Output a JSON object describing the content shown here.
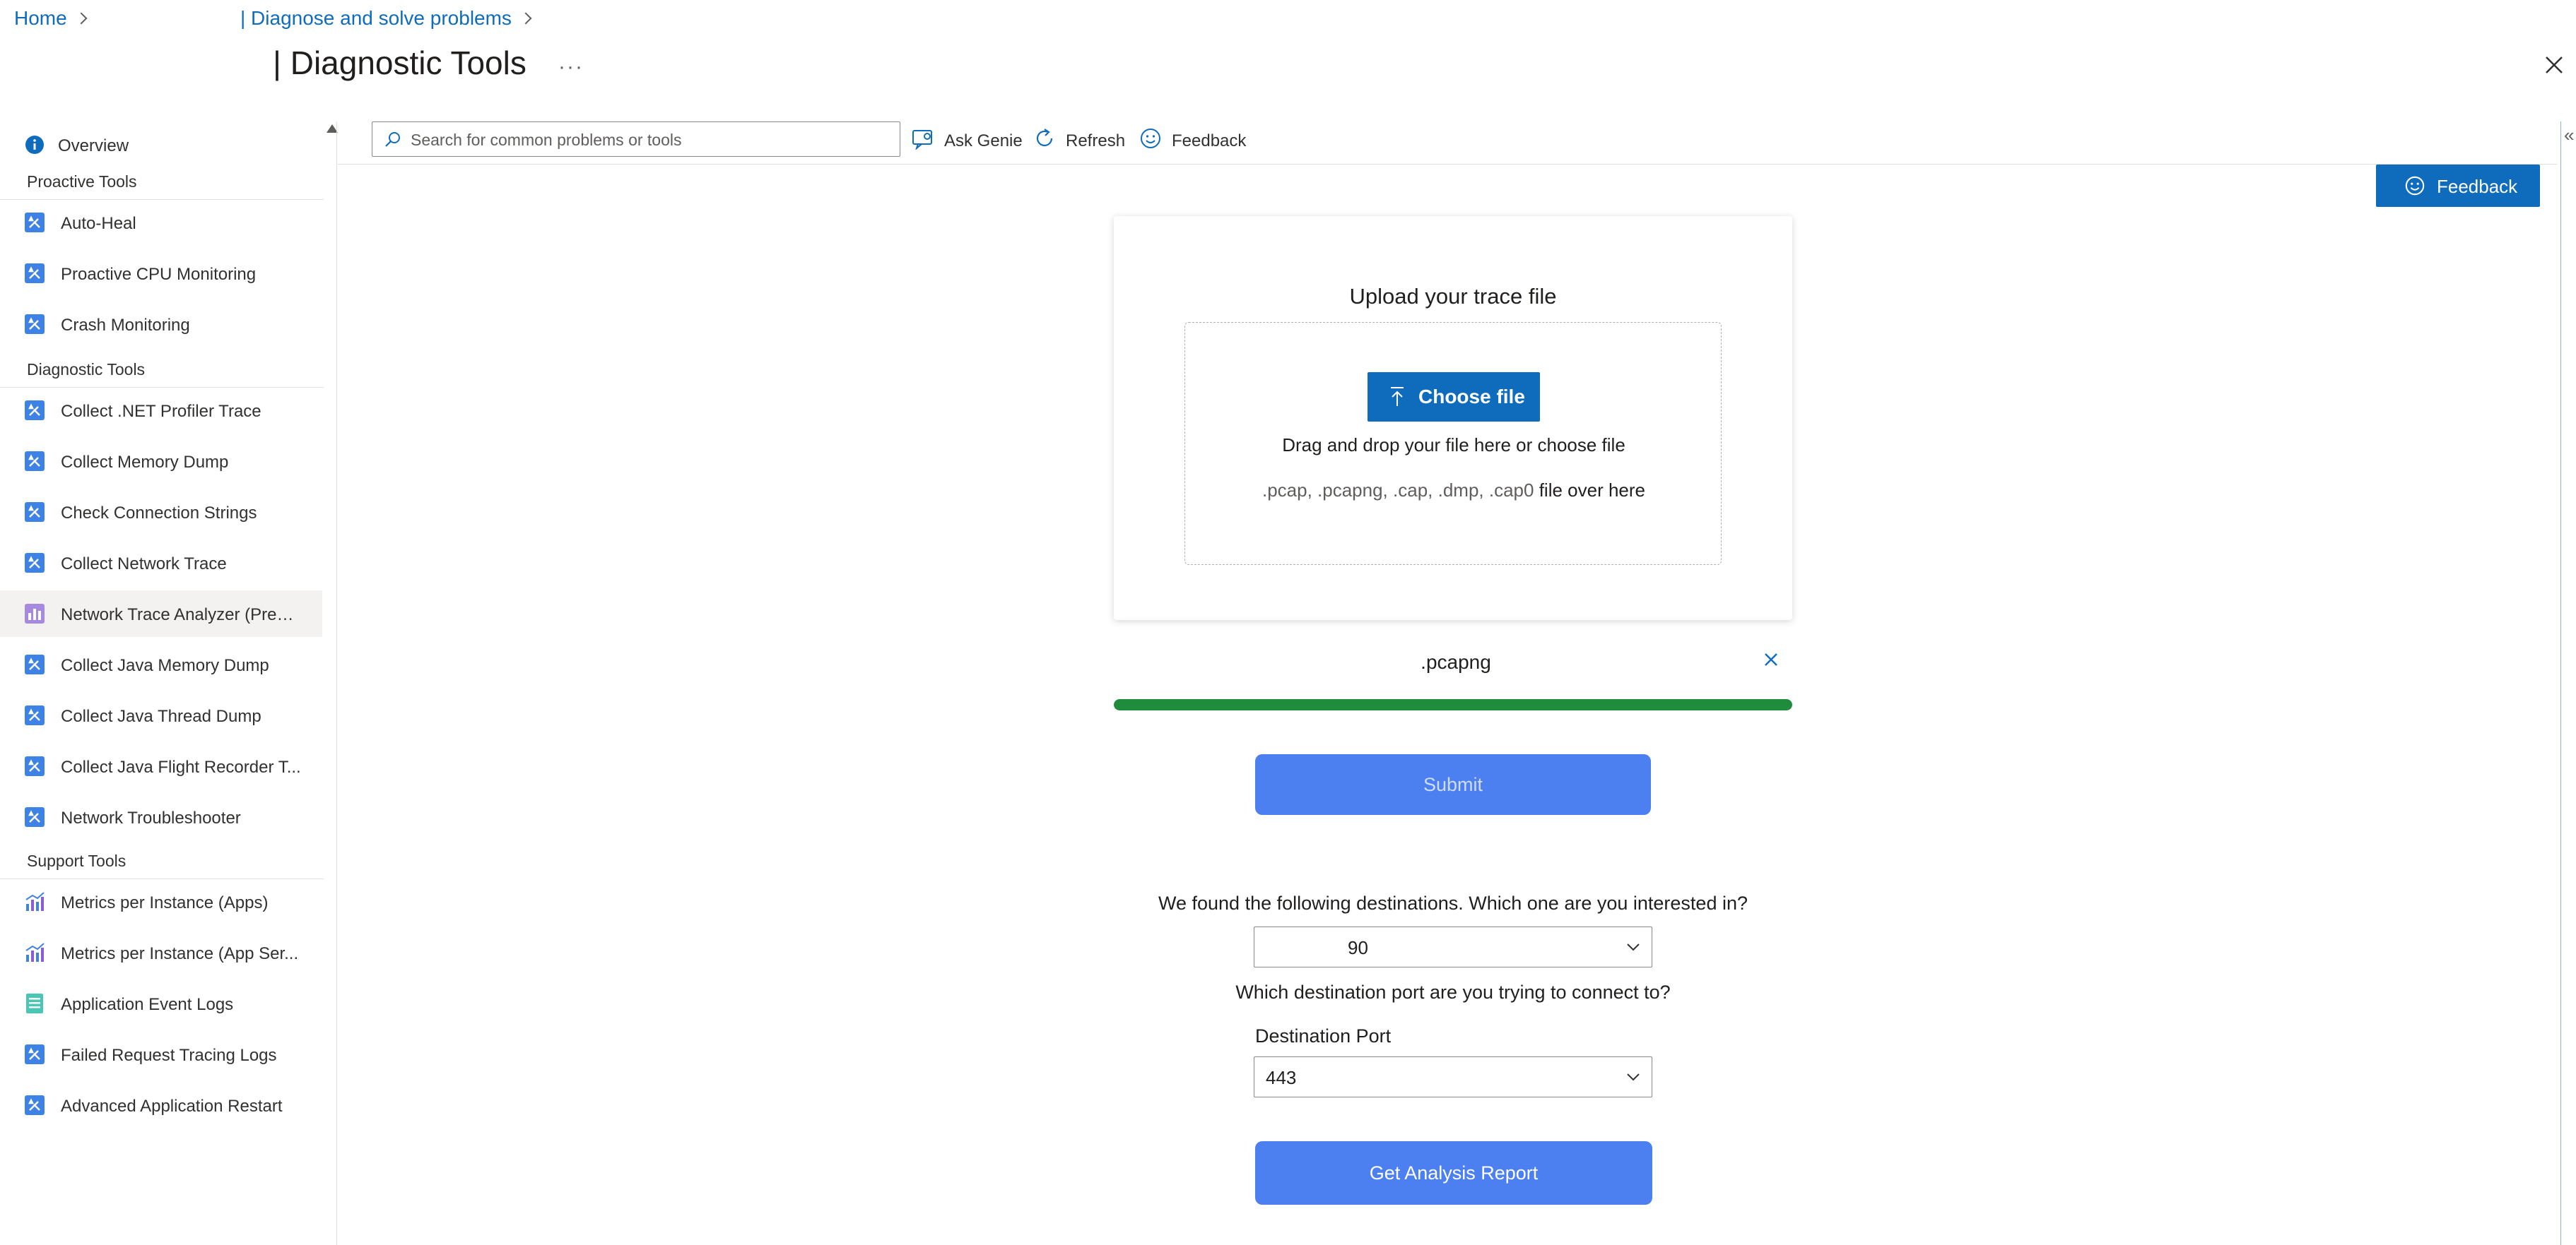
{
  "breadcrumb": {
    "home": "Home",
    "diagnose": "| Diagnose and solve problems"
  },
  "page": {
    "title": "| Diagnostic Tools",
    "more": "···"
  },
  "sidebar": {
    "overview": "Overview",
    "sections": [
      {
        "header": "Proactive Tools",
        "items": [
          "Auto-Heal",
          "Proactive CPU Monitoring",
          "Crash Monitoring"
        ]
      },
      {
        "header": "Diagnostic Tools",
        "items": [
          "Collect .NET Profiler Trace",
          "Collect Memory Dump",
          "Check Connection Strings",
          "Collect Network Trace",
          "Network Trace Analyzer (Previ...",
          "Collect Java Memory Dump",
          "Collect Java Thread Dump",
          "Collect Java Flight Recorder T...",
          "Network Troubleshooter"
        ]
      },
      {
        "header": "Support Tools",
        "items": [
          "Metrics per Instance (Apps)",
          "Metrics per Instance (App Ser...",
          "Application Event Logs",
          "Failed Request Tracing Logs",
          "Advanced Application Restart"
        ]
      }
    ],
    "selected": "Network Trace Analyzer (Previ..."
  },
  "toolbar": {
    "search_placeholder": "Search for common problems or tools",
    "ask_genie": "Ask Genie",
    "refresh": "Refresh",
    "feedback": "Feedback"
  },
  "feedback_button": "Feedback",
  "upload": {
    "title": "Upload your trace file",
    "choose_file": "Choose file",
    "drag_text": "Drag and drop your file here or choose file",
    "extensions": ".pcap, .pcapng, .cap, .dmp, .cap0",
    "over_here": "file over here"
  },
  "file": {
    "name": ".pcapng",
    "progress": 1.0
  },
  "submit_label": "Submit",
  "destinations": {
    "question": "We found the following destinations. Which one are you interested in?",
    "selected": "90"
  },
  "port": {
    "question": "Which destination port are you trying to connect to?",
    "label": "Destination Port",
    "selected": "443"
  },
  "report_label": "Get Analysis Report",
  "colors": {
    "accent": "#0f6cbd",
    "submit": "#4c80f0",
    "progress": "#1e8b3d"
  }
}
